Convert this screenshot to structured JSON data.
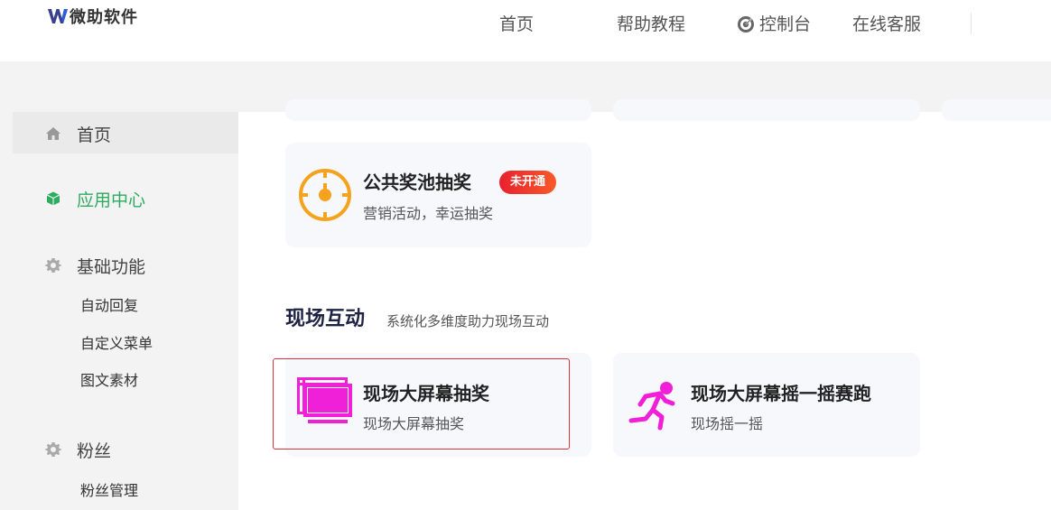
{
  "header": {
    "logo_text": "微助软件",
    "nav": {
      "home": "首页",
      "help": "帮助教程",
      "console": "控制台",
      "service": "在线客服"
    }
  },
  "sidebar": {
    "items": [
      {
        "label": "首页",
        "icon": "home-icon"
      },
      {
        "label": "应用中心",
        "icon": "cube-icon",
        "active_color": "#2dab5f"
      },
      {
        "label": "基础功能",
        "icon": "gear-icon"
      },
      {
        "label": "粉丝",
        "icon": "gear-icon"
      }
    ],
    "basic_sub": [
      "自动回复",
      "自定义菜单",
      "图文素材"
    ],
    "fans_sub": [
      "粉丝管理"
    ]
  },
  "cards": {
    "lottery": {
      "title": "公共奖池抽奖",
      "badge": "未开通",
      "desc": "营销活动，幸运抽奖",
      "icon": "dial-icon",
      "icon_color": "#f5a21f"
    },
    "bigscreen": {
      "title": "现场大屏幕抽奖",
      "desc": "现场大屏幕抽奖",
      "icon": "monitor-icon",
      "icon_color": "#f01fd8"
    },
    "shake": {
      "title": "现场大屏幕摇一摇赛跑",
      "desc": "现场摇一摇",
      "icon": "runner-icon",
      "icon_color": "#f01fd8"
    }
  },
  "section": {
    "title": "现场互动",
    "subtitle": "系统化多维度助力现场互动"
  },
  "colors": {
    "accent_green": "#2dab5f",
    "badge_red": "#e8202e",
    "selection_red": "#e02f3b",
    "card_bg": "#f7f8fc"
  }
}
